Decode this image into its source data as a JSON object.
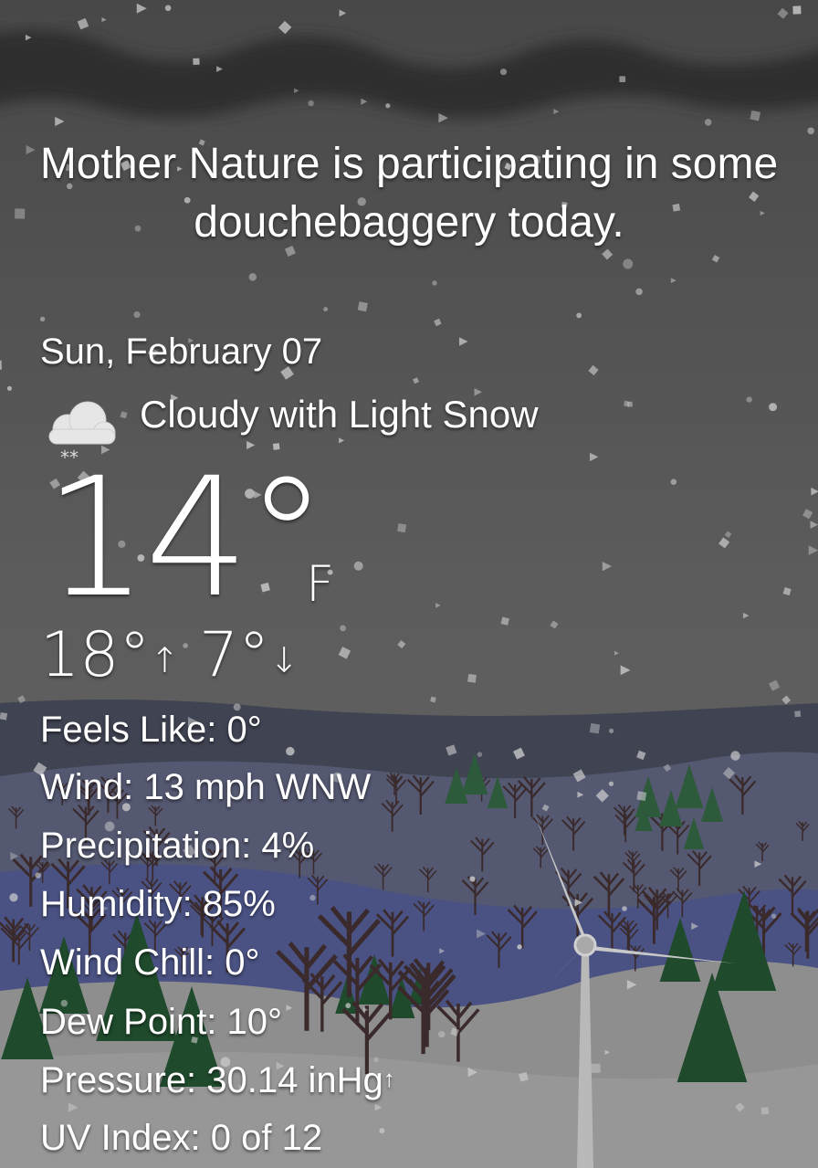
{
  "headline": "Mother Nature is participating in some douchebaggery today.",
  "date": "Sun, February 07",
  "condition": {
    "icon": "cloud-snow-icon",
    "text": "Cloudy with Light Snow"
  },
  "temperature": {
    "value": "14°",
    "unit": "F"
  },
  "high": "18°",
  "high_arrow": "↑",
  "low": "7°",
  "low_arrow": "↓",
  "details": {
    "feels_like": "Feels Like: 0°",
    "wind": "Wind: 13 mph WNW",
    "precipitation": "Precipitation: 4%",
    "humidity": "Humidity: 85%",
    "wind_chill": "Wind Chill: 0°",
    "dew_point": "Dew Point: 10°",
    "pressure": "Pressure: 30.14 inHg",
    "pressure_arrow": "↑",
    "uv_index": "UV Index: 0 of 12"
  },
  "colors": {
    "sky": "#5a5a5a",
    "storm_cloud": "#3a3a3a",
    "far_hill": "#3e4350",
    "mid_hill": "#545870",
    "near_hill": "#4c5480",
    "snow_ground": "#8f8f8f",
    "tree_green": "#1f4a2c",
    "bare_tree": "#3b2a2a"
  }
}
